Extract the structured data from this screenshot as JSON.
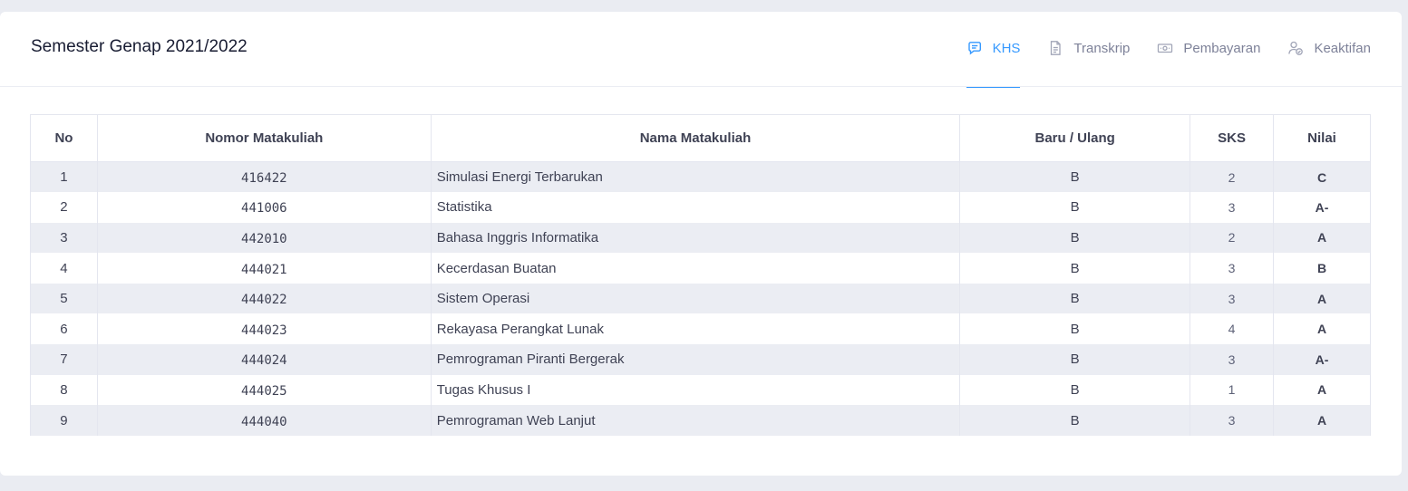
{
  "card": {
    "title": "Semester Genap 2021/2022"
  },
  "tabs": [
    {
      "label": "KHS",
      "icon": "chat-icon",
      "active": true
    },
    {
      "label": "Transkrip",
      "icon": "document-icon",
      "active": false
    },
    {
      "label": "Pembayaran",
      "icon": "money-icon",
      "active": false
    },
    {
      "label": "Keaktifan",
      "icon": "user-check-icon",
      "active": false
    }
  ],
  "colors": {
    "accent": "#3699ff",
    "stripe": "#ebedf3",
    "muted": "#7e8299"
  },
  "table": {
    "headers": [
      "No",
      "Nomor Matakuliah",
      "Nama Matakuliah",
      "Baru / Ulang",
      "SKS",
      "Nilai"
    ],
    "rows": [
      {
        "no": "1",
        "kode": "416422",
        "nama": "Simulasi Energi Terbarukan",
        "status": "B",
        "sks": "2",
        "nilai": "C"
      },
      {
        "no": "2",
        "kode": "441006",
        "nama": "Statistika",
        "status": "B",
        "sks": "3",
        "nilai": "A-"
      },
      {
        "no": "3",
        "kode": "442010",
        "nama": "Bahasa Inggris Informatika",
        "status": "B",
        "sks": "2",
        "nilai": "A"
      },
      {
        "no": "4",
        "kode": "444021",
        "nama": "Kecerdasan Buatan",
        "status": "B",
        "sks": "3",
        "nilai": "B"
      },
      {
        "no": "5",
        "kode": "444022",
        "nama": "Sistem Operasi",
        "status": "B",
        "sks": "3",
        "nilai": "A"
      },
      {
        "no": "6",
        "kode": "444023",
        "nama": "Rekayasa Perangkat Lunak",
        "status": "B",
        "sks": "4",
        "nilai": "A"
      },
      {
        "no": "7",
        "kode": "444024",
        "nama": "Pemrograman Piranti Bergerak",
        "status": "B",
        "sks": "3",
        "nilai": "A-"
      },
      {
        "no": "8",
        "kode": "444025",
        "nama": "Tugas Khusus I",
        "status": "B",
        "sks": "1",
        "nilai": "A"
      },
      {
        "no": "9",
        "kode": "444040",
        "nama": "Pemrograman Web Lanjut",
        "status": "B",
        "sks": "3",
        "nilai": "A"
      }
    ]
  }
}
